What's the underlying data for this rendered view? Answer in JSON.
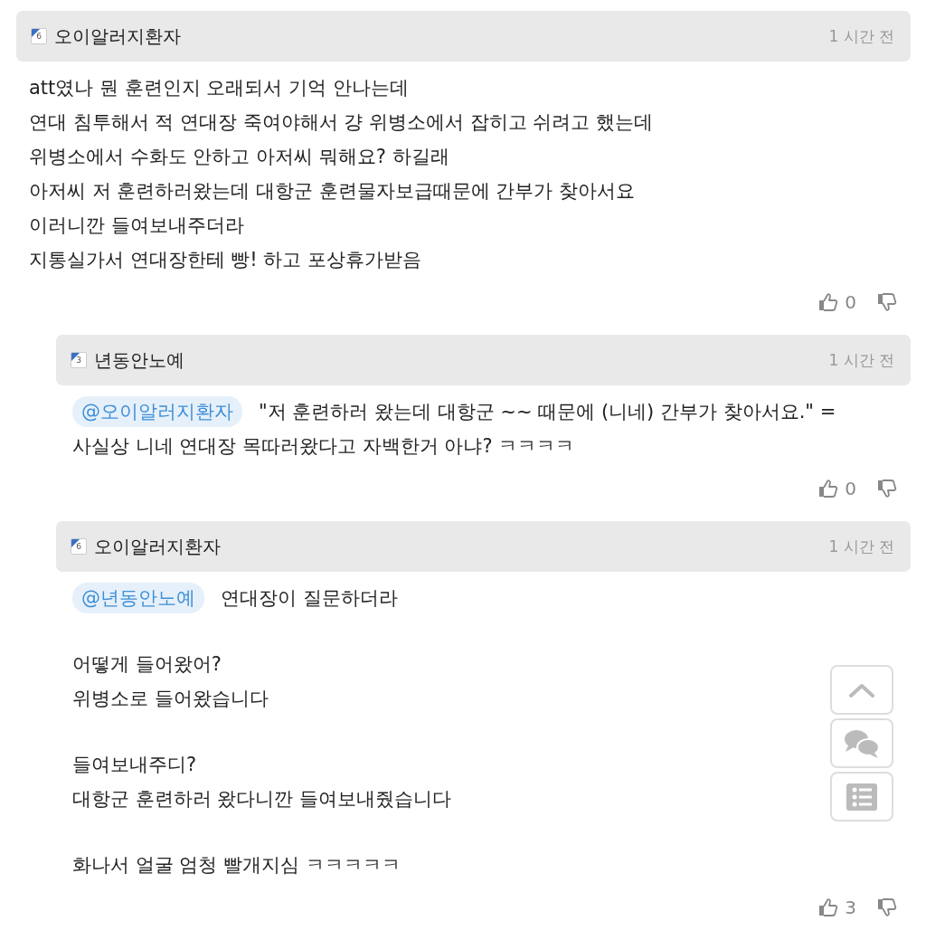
{
  "comments": [
    {
      "kind": "comment",
      "author": "오이알러지환자",
      "badge": "6",
      "time": "1 시간 전",
      "paragraphs": [
        [
          "att였나 뭔 훈련인지 오래되서 기억 안나는데",
          "연대 침투해서 적 연대장 죽여야해서 걍 위병소에서 잡히고 쉬려고 했는데",
          "위병소에서 수화도 안하고 아저씨 뭐해요? 하길래",
          "아저씨 저 훈련하러왔는데 대항군 훈련물자보급때문에 간부가 찾아서요",
          "이러니깐 들여보내주더라",
          "지통실가서 연대장한테 빵! 하고 포상휴가받음"
        ]
      ],
      "likes": "0"
    },
    {
      "kind": "reply",
      "author": "년동안노예",
      "badge": "3",
      "time": "1 시간 전",
      "mention": "@오이알러지환자",
      "paragraphs": [
        [
          "\"저 훈련하러 왔는데 대항군 ~~ 때문에 (니네) 간부가 찾아서요.\" =",
          "사실상 니네 연대장 목따러왔다고 자백한거 아냐? ㅋㅋㅋㅋ"
        ]
      ],
      "likes": "0"
    },
    {
      "kind": "reply",
      "author": "오이알러지환자",
      "badge": "6",
      "time": "1 시간 전",
      "mention": "@년동안노예",
      "paragraphs": [
        [
          "연대장이 질문하더라"
        ],
        [
          "어떻게 들어왔어?",
          "위병소로 들어왔습니다"
        ],
        [
          "들여보내주디?",
          "대항군 훈련하러 왔다니깐 들여보내줬습니다"
        ],
        [
          "화나서 얼굴 엄청 빨개지심 ㅋㅋㅋㅋㅋ"
        ]
      ],
      "likes": "3"
    }
  ]
}
